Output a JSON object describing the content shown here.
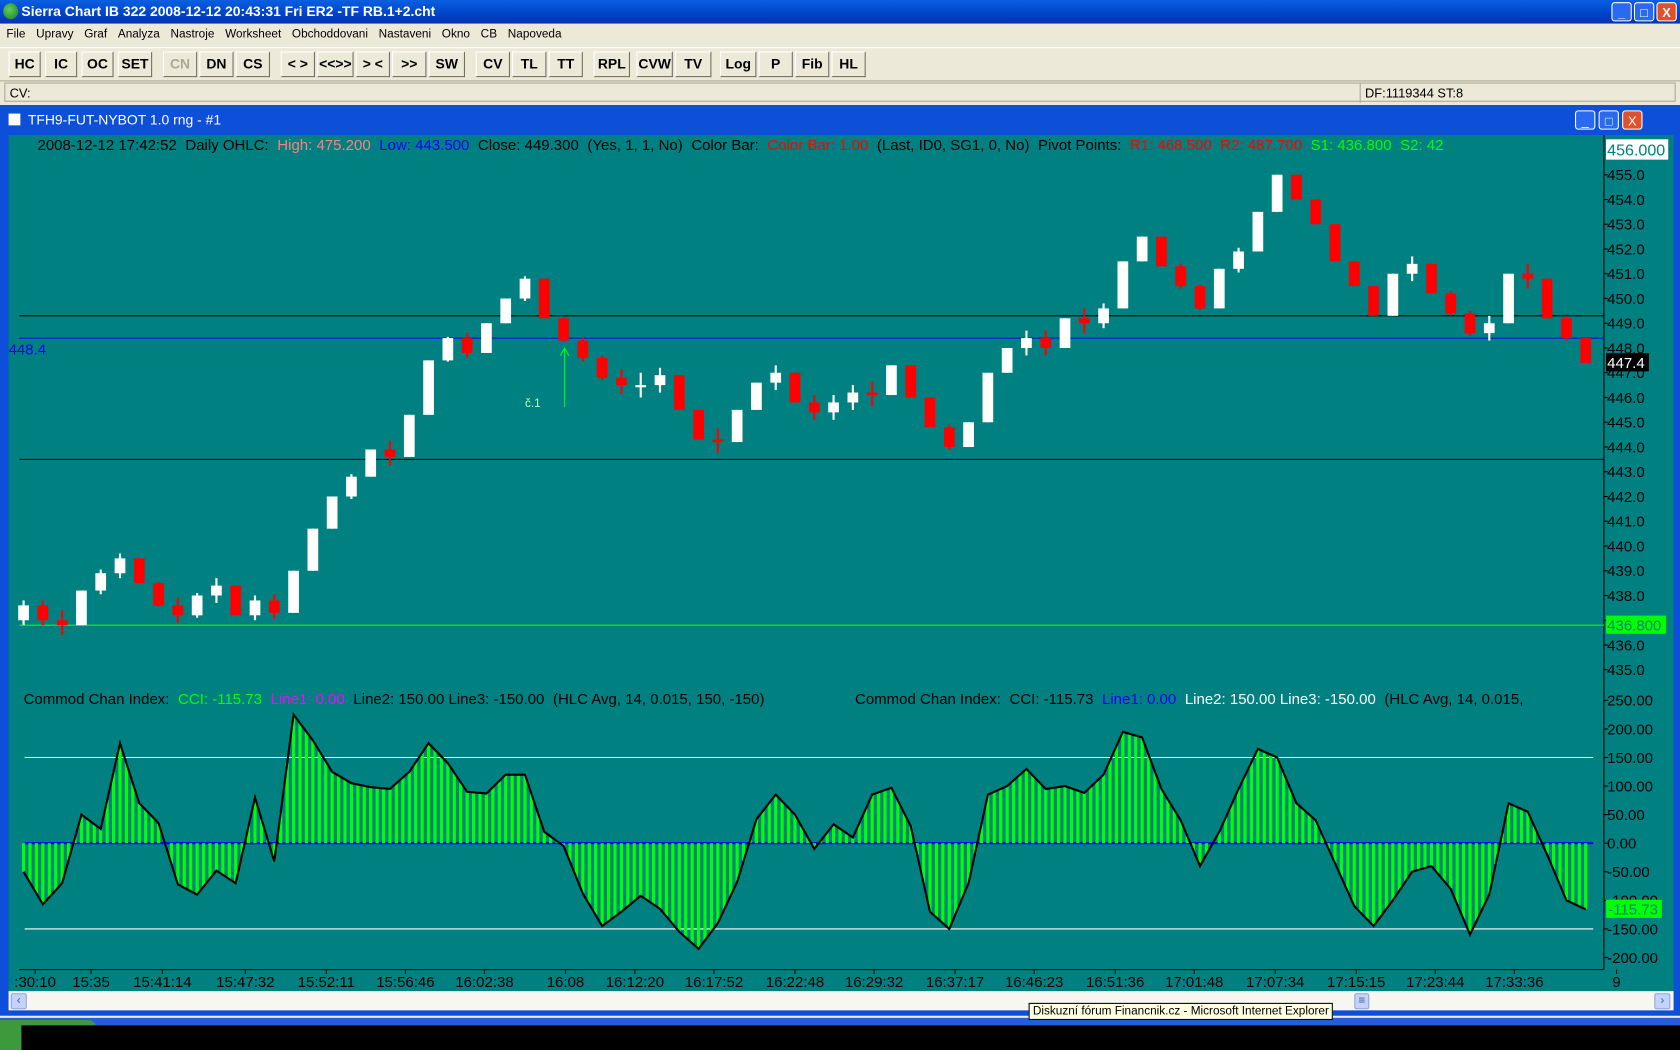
{
  "window": {
    "title": "Sierra Chart IB 322  2008-12-12  20:43:31  Fri   ER2 -TF RB.1+2.cht",
    "min": "_",
    "max": "□",
    "close": "X"
  },
  "menu": [
    "File",
    "Upravy",
    "Graf",
    "Analyza",
    "Nastroje",
    "Worksheet",
    "Obchoddovani",
    "Nastaveni",
    "Okno",
    "CB",
    "Napoveda"
  ],
  "toolbar": [
    {
      "label": "HC",
      "enabled": true
    },
    {
      "label": "IC",
      "enabled": true
    },
    {
      "label": "OC",
      "enabled": true
    },
    {
      "label": "SET",
      "enabled": true
    },
    {
      "label": "CN",
      "enabled": false
    },
    {
      "label": "DN",
      "enabled": true
    },
    {
      "label": "CS",
      "enabled": true
    },
    {
      "label": "< >",
      "enabled": true
    },
    {
      "label": "<<>>",
      "enabled": true
    },
    {
      "label": "> <",
      "enabled": true
    },
    {
      "label": ">><<",
      "enabled": true
    },
    {
      "label": "SW",
      "enabled": true
    },
    {
      "label": "CV",
      "enabled": true
    },
    {
      "label": "TL",
      "enabled": true
    },
    {
      "label": "TT",
      "enabled": true
    },
    {
      "label": "RPL",
      "enabled": true
    },
    {
      "label": "CVW",
      "enabled": true
    },
    {
      "label": "TV",
      "enabled": true
    },
    {
      "label": "Log",
      "enabled": true
    },
    {
      "label": "P",
      "enabled": true
    },
    {
      "label": "Fib",
      "enabled": true
    },
    {
      "label": "HL",
      "enabled": true
    }
  ],
  "cvbar": {
    "label": "CV:",
    "status": "DF:1119344  ST:8"
  },
  "chart_window": {
    "title": "TFH9-FUT-NYBOT  1.0 rng - #1"
  },
  "price_header": [
    {
      "text": "2008-12-12  17:42:52",
      "color": "#000000"
    },
    {
      "text": "Daily OHLC:",
      "color": "#000000"
    },
    {
      "text": "High: 475.200",
      "color": "#ff8080"
    },
    {
      "text": "Low: 443.500",
      "color": "#0000ff"
    },
    {
      "text": "Close: 449.300",
      "color": "#000000"
    },
    {
      "text": "(Yes, 1, 1, No)",
      "color": "#000000"
    },
    {
      "text": "Color Bar:",
      "color": "#000000"
    },
    {
      "text": "Color Bar: 1.00",
      "color": "#ff0000"
    },
    {
      "text": "(Last, ID0, SG1, 0, No)",
      "color": "#000000"
    },
    {
      "text": "Pivot Points:",
      "color": "#000000"
    },
    {
      "text": "R1: 468.500",
      "color": "#ff0000"
    },
    {
      "text": "R2: 487.700",
      "color": "#ff0000"
    },
    {
      "text": "S1: 436.800",
      "color": "#00ff00"
    },
    {
      "text": "S2: 42",
      "color": "#00ff00"
    }
  ],
  "cci_header_1": [
    {
      "text": "Commod Chan Index:",
      "color": "#000000"
    },
    {
      "text": "CCI: -115.73",
      "color": "#00ff00"
    },
    {
      "text": "Line1: 0.00",
      "color": "#ff00ff"
    },
    {
      "text": "Line2: 150.00  Line3: -150.00",
      "color": "#000000"
    },
    {
      "text": "(HLC Avg, 14, 0.015, 150, -150)",
      "color": "#000000"
    }
  ],
  "cci_header_2": [
    {
      "text": "Commod Chan Index:",
      "color": "#000000"
    },
    {
      "text": "CCI: -115.73",
      "color": "#000000"
    },
    {
      "text": "Line1: 0.00",
      "color": "#0000ff"
    },
    {
      "text": "Line2: 150.00  Line3: -150.00",
      "color": "#ffffff"
    },
    {
      "text": "(HLC Avg, 14, 0.015,",
      "color": "#000000"
    }
  ],
  "annotation": {
    "text": "č.1"
  },
  "left_marker": {
    "text": "448.4"
  },
  "tooltip": "Diskuzní fórum Financnik.cz - Microsoft Internet Explorer",
  "colors": {
    "background": "#008080",
    "up": "#ffffff",
    "down": "#ff0000",
    "cci": "#00ff00"
  },
  "chart_data": [
    {
      "type": "candlestick",
      "title": "TFH9-FUT-NYBOT 1.0 rng",
      "bar_range": 1.0,
      "first_open": 437.0,
      "closes": [
        437.6,
        437.0,
        436.8,
        438.2,
        438.9,
        439.5,
        438.5,
        437.6,
        437.2,
        438.0,
        438.4,
        437.2,
        437.8,
        437.3,
        439.0,
        440.7,
        442.0,
        442.8,
        443.9,
        443.6,
        445.3,
        447.5,
        448.4,
        447.8,
        449.0,
        450.0,
        450.8,
        449.2,
        448.3,
        447.6,
        446.8,
        446.5,
        446.5,
        446.9,
        445.5,
        444.3,
        444.2,
        445.5,
        446.6,
        447.0,
        445.8,
        445.4,
        445.8,
        446.2,
        446.1,
        447.3,
        446.0,
        444.8,
        444.0,
        445.0,
        447.0,
        448.0,
        448.4,
        448.0,
        449.2,
        449.0,
        449.6,
        451.5,
        452.5,
        451.3,
        450.5,
        449.6,
        451.2,
        451.9,
        453.5,
        455.0,
        454.0,
        453.0,
        451.5,
        450.5,
        449.3,
        451.0,
        451.4,
        450.2,
        449.4,
        448.6,
        449.0,
        451.0,
        450.8,
        449.2,
        448.4,
        447.4
      ],
      "ylim": [
        434.5,
        456.3
      ],
      "yticks": [
        456,
        455,
        454,
        453,
        452,
        451,
        450,
        449,
        448,
        447,
        446,
        445,
        444,
        443,
        442,
        441,
        440,
        439,
        438,
        437,
        436,
        435
      ],
      "top_label": "456.000",
      "last_label": "447.4",
      "hlines": [
        {
          "name": "close-line",
          "value": 449.3,
          "color": "#000000"
        },
        {
          "name": "cursor-line",
          "value": 448.4,
          "color": "#0000ff"
        },
        {
          "name": "low-line",
          "value": 443.5,
          "color": "#000000"
        },
        {
          "name": "s1-line",
          "value": 436.8,
          "color": "#00ff00",
          "label": "436.800"
        }
      ]
    },
    {
      "type": "bar",
      "title": "Commod Chan Index",
      "values": [
        -50,
        -107,
        -70,
        50,
        25,
        175,
        70,
        35,
        -72,
        -90,
        -48,
        -70,
        80,
        -32,
        225,
        180,
        125,
        105,
        98,
        95,
        125,
        175,
        140,
        90,
        87,
        120,
        120,
        20,
        -5,
        -88,
        -145,
        -120,
        -92,
        -115,
        -155,
        -185,
        -140,
        -68,
        42,
        85,
        50,
        -10,
        33,
        10,
        85,
        97,
        30,
        -120,
        -150,
        -70,
        85,
        100,
        130,
        95,
        100,
        88,
        120,
        195,
        185,
        95,
        40,
        -40,
        20,
        95,
        165,
        150,
        70,
        40,
        -35,
        -110,
        -145,
        -100,
        -50,
        -40,
        -80,
        -160,
        -90,
        70,
        55,
        -20,
        -100,
        -115.73
      ],
      "ylim": [
        -215,
        255
      ],
      "yticks": [
        250,
        200,
        150,
        100,
        50,
        0,
        -50,
        -100,
        -150,
        -200
      ],
      "last_label": "-115.73",
      "hlines": [
        {
          "value": 150,
          "color": "#ffffff"
        },
        {
          "value": 0,
          "color": "#0000ff"
        },
        {
          "value": -150,
          "color": "#ffffff"
        }
      ]
    },
    {
      "type": "xaxis",
      "labels": [
        {
          "text": ":30:10",
          "bar": 0.6
        },
        {
          "text": "15:35",
          "bar": 3.5
        },
        {
          "text": "15:41:14",
          "bar": 7.2
        },
        {
          "text": "15:47:32",
          "bar": 11.5
        },
        {
          "text": "15:52:11",
          "bar": 15.7
        },
        {
          "text": "15:56:46",
          "bar": 19.8
        },
        {
          "text": "16:02:38",
          "bar": 23.9
        },
        {
          "text": "16:08",
          "bar": 28.1
        },
        {
          "text": "16:12:20",
          "bar": 31.7
        },
        {
          "text": "16:17:52",
          "bar": 35.8
        },
        {
          "text": "16:22:48",
          "bar": 40
        },
        {
          "text": "16:29:32",
          "bar": 44.1
        },
        {
          "text": "16:37:17",
          "bar": 48.3
        },
        {
          "text": "16:46:23",
          "bar": 52.4
        },
        {
          "text": "16:51:36",
          "bar": 56.6
        },
        {
          "text": "17:01:48",
          "bar": 60.7
        },
        {
          "text": "17:07:34",
          "bar": 64.9
        },
        {
          "text": "17:15:15",
          "bar": 69.1
        },
        {
          "text": "17:23:44",
          "bar": 73.2
        },
        {
          "text": "17:33:36",
          "bar": 77.3
        },
        {
          "text": "9",
          "bar": 82.6
        }
      ]
    }
  ]
}
